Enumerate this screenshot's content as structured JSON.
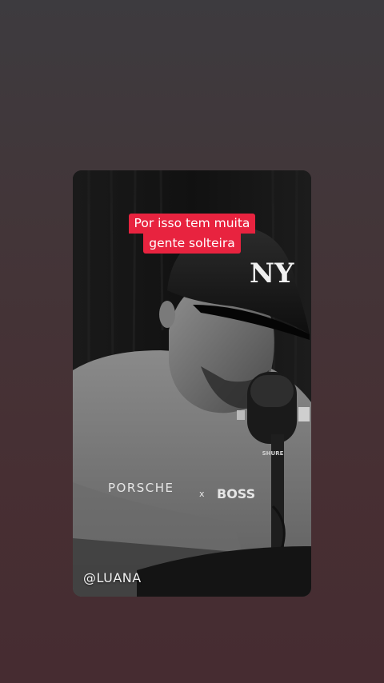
{
  "video": {
    "caption_line_1": "Por isso tem muita",
    "caption_line_2": "gente solteira",
    "watermark": "@LUANA",
    "shirt_text_left": "PORSCHE",
    "shirt_text_x": "x",
    "shirt_text_right": "BOSS",
    "cap_logo": "NY",
    "mic_brand": "SHURE"
  },
  "colors": {
    "caption_bg": "#e8233f",
    "caption_text": "#ffffff",
    "page_bg_top": "#3d3b3f",
    "page_bg_bottom": "#462c31"
  }
}
